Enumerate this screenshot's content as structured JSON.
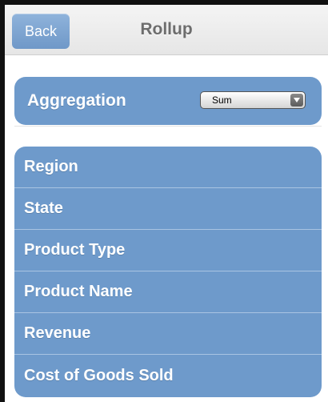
{
  "navbar": {
    "back_label": "Back",
    "title": "Rollup"
  },
  "aggregation": {
    "label": "Aggregation",
    "selected": "Sum"
  },
  "fields": {
    "items": [
      {
        "label": "Region"
      },
      {
        "label": "State"
      },
      {
        "label": "Product Type"
      },
      {
        "label": "Product Name"
      },
      {
        "label": "Revenue"
      },
      {
        "label": "Cost of Goods Sold"
      }
    ]
  },
  "colors": {
    "accent": "#6e9acb",
    "back_button": "#7ea6d4",
    "title_text": "#6d6d6d"
  }
}
